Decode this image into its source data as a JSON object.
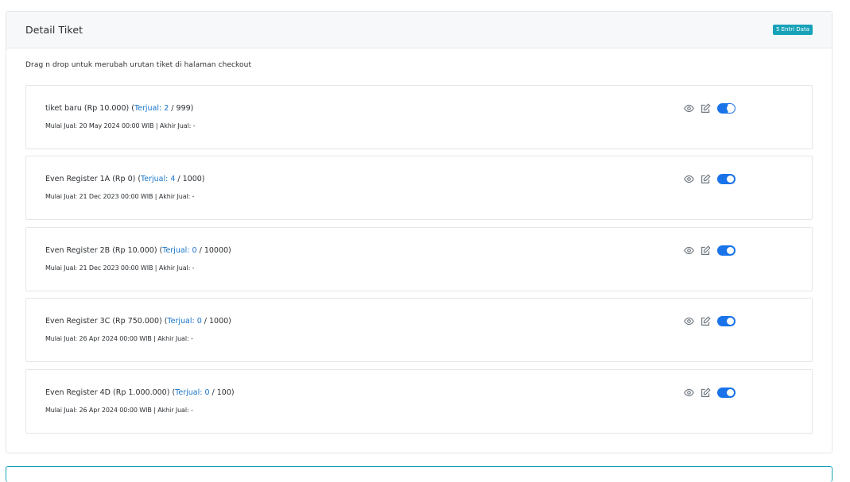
{
  "card": {
    "title": "Detail Tiket",
    "badge": "5 Entri Data",
    "hint": "Drag n drop untuk merubah urutan tiket di halaman checkout"
  },
  "tickets": [
    {
      "name": "tiket baru (Rp 10.000) (",
      "sold": "Terjual: 2",
      "quota": " / 999)",
      "dates": "Mulai Jual: 20 May 2024 00:00 WIB | Akhir Jual: -",
      "active": true
    },
    {
      "name": "Even Register 1A (Rp 0) (",
      "sold": "Terjual: 4",
      "quota": " / 1000)",
      "dates": "Mulai Jual: 21 Dec 2023 00:00 WIB | Akhir Jual: -",
      "active": true
    },
    {
      "name": "Even Register 2B (Rp 10.000) (",
      "sold": "Terjual: 0",
      "quota": " / 10000)",
      "dates": "Mulai Jual: 21 Dec 2023 00:00 WIB | Akhir Jual: -",
      "active": true
    },
    {
      "name": "Even Register 3C (Rp 750.000) (",
      "sold": "Terjual: 0",
      "quota": " / 1000)",
      "dates": "Mulai Jual: 26 Apr 2024 00:00 WIB | Akhir Jual: -",
      "active": true
    },
    {
      "name": "Even Register 4D (Rp 1.000.000) (",
      "sold": "Terjual: 0",
      "quota": " / 100)",
      "dates": "Mulai Jual: 26 Apr 2024 00:00 WIB | Akhir Jual: -",
      "active": true
    }
  ],
  "icons": {
    "view": "eye-icon",
    "edit": "edit-icon",
    "toggle": "toggle-switch"
  },
  "colors": {
    "accent": "#1a73e8",
    "sold_link": "#1874c7",
    "badge": "#17a2b8"
  }
}
